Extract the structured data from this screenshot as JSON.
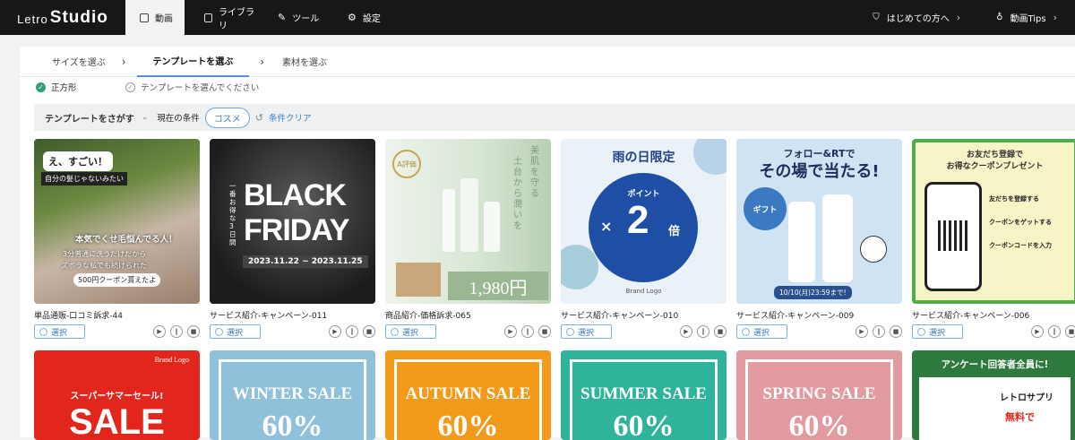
{
  "app": {
    "logo_a": "Letro",
    "logo_b": "Studio"
  },
  "nav": {
    "tabs": [
      {
        "label": "動画",
        "icon": "video-icon"
      },
      {
        "label": "ライブラリ",
        "icon": "folder-icon"
      },
      {
        "label": "ツール",
        "icon": "wrench-icon"
      },
      {
        "label": "設定",
        "icon": "gear-icon"
      }
    ],
    "right": [
      {
        "label": "はじめての方へ",
        "icon": "shield-icon"
      },
      {
        "label": "動画Tips",
        "icon": "bulb-icon"
      }
    ]
  },
  "steps": [
    "サイズを選ぶ",
    "テンプレートを選ぶ",
    "素材を選ぶ"
  ],
  "status": {
    "size": "正方形",
    "template": "テンプレートを選んでください"
  },
  "filter": {
    "search_label": "テンプレートをさがす",
    "current_label": "現在の条件",
    "chip": "コスメ",
    "clear_label": "条件クリア"
  },
  "select_label": "選択",
  "cards_row1": [
    {
      "title": "単品通販-口コミ訴求-44",
      "overlay": [
        "え、すごい！",
        "自分の髪じゃないみたい",
        "本気でくせ毛悩んでる人！",
        "3分普通に洗うだけだから",
        "ズボラな私でも続けられた",
        "500円クーポン貰えたよ"
      ]
    },
    {
      "title": "サービス紹介-キャンペーン-011",
      "overlay": [
        "一番お得な3日間",
        "BLACK",
        "FRIDAY",
        "2023.11.22 ~ 2023.11.25"
      ]
    },
    {
      "title": "商品紹介-価格訴求-065",
      "overlay": [
        "美肌を守る",
        "土台から潤いを",
        "1,980円",
        "A評価"
      ]
    },
    {
      "title": "サービス紹介-キャンペーン-010",
      "overlay": [
        "雨の日限定",
        "ポイント",
        "×",
        "2",
        "倍",
        "Brand Logo"
      ]
    },
    {
      "title": "サービス紹介-キャンペーン-009",
      "overlay": [
        "フォロー&RTで",
        "その場で当たる!",
        "ギフト",
        "10/10(月)23:59まで!"
      ]
    },
    {
      "title": "サービス紹介-キャンペーン-006",
      "overlay": [
        "お友だち登録で",
        "お得なクーポンプレゼント",
        "友だちを登録する",
        "クーポンをゲットする",
        "クーポンコードを入力"
      ]
    }
  ],
  "cards_row2": [
    {
      "overlay": [
        "Brand Logo",
        "スーパーサマーセール!",
        "SALE"
      ]
    },
    {
      "overlay": [
        "WINTER SALE",
        "60%"
      ]
    },
    {
      "overlay": [
        "AUTUMN SALE",
        "60%"
      ]
    },
    {
      "overlay": [
        "SUMMER SALE",
        "60%"
      ]
    },
    {
      "overlay": [
        "SPRING SALE",
        "60%"
      ]
    },
    {
      "overlay": [
        "アンケート回答者全員に!",
        "レトロサプリ",
        "無料で"
      ]
    }
  ],
  "colors": {
    "accent": "#3e7fc0",
    "topbar": "#17171a",
    "check": "#2e9f7f"
  }
}
